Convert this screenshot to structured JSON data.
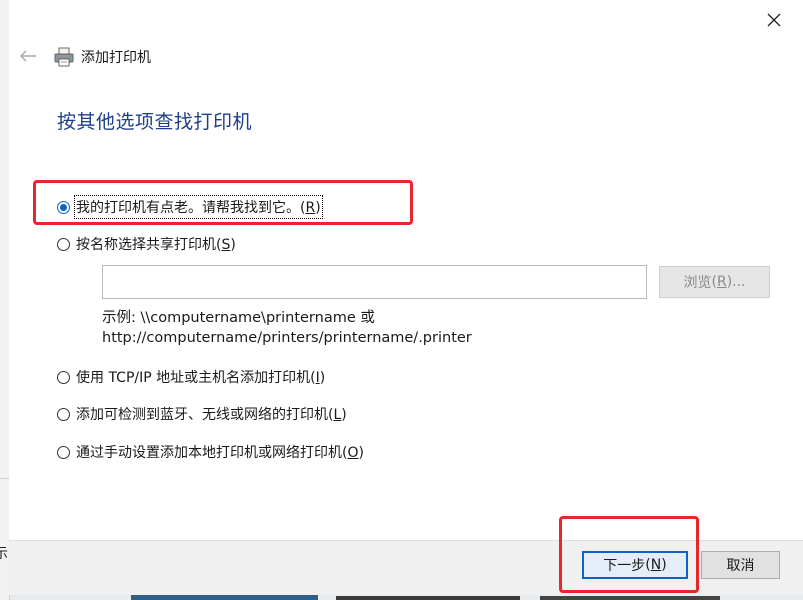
{
  "background": {
    "left_fragment_text": "示"
  },
  "dialog": {
    "title": "添加打印机",
    "heading": "按其他选项查找打印机",
    "icons": {
      "close": "close-icon",
      "back": "back-arrow-icon",
      "printer": "printer-icon"
    },
    "options": [
      {
        "label": "我的打印机有点老。请帮我找到它。",
        "key": "R",
        "checked": true
      },
      {
        "label": "按名称选择共享打印机",
        "key": "S",
        "checked": false
      },
      {
        "label": "使用 TCP/IP 地址或主机名添加打印机",
        "key": "I",
        "checked": false
      },
      {
        "label": "添加可检测到蓝牙、无线或网络的打印机",
        "key": "L",
        "checked": false
      },
      {
        "label": "通过手动设置添加本地打印机或网络打印机",
        "key": "O",
        "checked": false
      }
    ],
    "shared_printer": {
      "input_value": "",
      "browse_label": "浏览",
      "browse_key": "R",
      "example_line1": "示例: \\\\computername\\printername 或",
      "example_line2": "http://computername/printers/printername/.printer"
    },
    "footer": {
      "next_label": "下一步",
      "next_key": "N",
      "cancel_label": "取消"
    }
  },
  "colors": {
    "heading": "#1e3f8a",
    "accent": "#0b63c7",
    "annotation": "#e8272b"
  }
}
